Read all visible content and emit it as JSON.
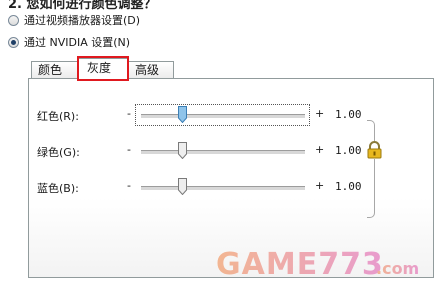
{
  "heading": "2. 您如何进行颜色调整？",
  "radio_options": [
    {
      "label": "通过视频播放器设置(D)",
      "checked": false
    },
    {
      "label": "通过 NVIDIA 设置(N)",
      "checked": true
    }
  ],
  "tabs": [
    {
      "label": "颜色",
      "active": false
    },
    {
      "label": "灰度",
      "active": true
    },
    {
      "label": "高级",
      "active": false
    }
  ],
  "sliders": [
    {
      "label": "红色(R):",
      "minus": "-",
      "plus": "+",
      "value": "1.00",
      "level": 0.25,
      "focused": true
    },
    {
      "label": "绿色(G):",
      "minus": "-",
      "plus": "+",
      "value": "1.00",
      "level": 0.25,
      "focused": false
    },
    {
      "label": "蓝色(B):",
      "minus": "-",
      "plus": "+",
      "value": "1.00",
      "level": 0.25,
      "focused": false
    }
  ],
  "lock_icon": "padlock-icon",
  "watermark_text": "GAME773.com",
  "colors": {
    "highlight": "#e0191f",
    "lock": "#e8b820",
    "focused_thumb": "#8fc4ea",
    "watermark_gradient_start": "#f06a1a",
    "watermark_gradient_end": "#d92fa0"
  }
}
